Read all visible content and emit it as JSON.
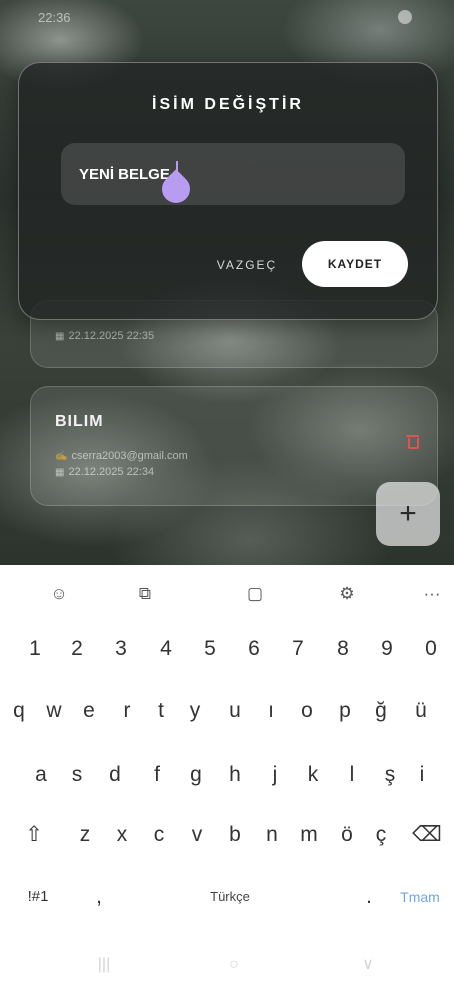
{
  "status": {
    "time": "22:36"
  },
  "dialog": {
    "title": "İSİM DEĞİŞTİR",
    "input_value": "YENİ BELGE",
    "cancel": "VAZGEÇ",
    "save": "KAYDET"
  },
  "docs": [
    {
      "title": "",
      "email": "",
      "date": "22.12.2025 22:35"
    },
    {
      "title": "BILIM",
      "email": "cserra2003@gmail.com",
      "date": "22.12.2025 22:34"
    }
  ],
  "fab": {
    "label": "+"
  },
  "keyboard": {
    "toolbar": [
      "emoji-icon",
      "translate-icon",
      "clipboard-icon",
      "settings-icon",
      "more-icon"
    ],
    "toolbar_glyphs": [
      "☺",
      "⧉",
      "▢",
      "⚙",
      "···"
    ],
    "numbers": [
      "1",
      "2",
      "3",
      "4",
      "5",
      "6",
      "7",
      "8",
      "9",
      "0"
    ],
    "row1": [
      "q",
      "w",
      "e",
      "r",
      "t",
      "y",
      "u",
      "ı",
      "o",
      "p",
      "ğ",
      "ü"
    ],
    "row2": [
      "a",
      "s",
      "d",
      "f",
      "g",
      "h",
      "j",
      "k",
      "l",
      "ş",
      "i"
    ],
    "row3": [
      "z",
      "x",
      "c",
      "v",
      "b",
      "n",
      "m",
      "ö",
      "ç"
    ],
    "shift": "⇧",
    "backspace": "⌫",
    "symbols": "!#1",
    "comma": ",",
    "space": "Türkçe",
    "period": ".",
    "done": "Tmam"
  },
  "nav": {
    "recent": "|||",
    "home": "○",
    "back": "∨"
  }
}
